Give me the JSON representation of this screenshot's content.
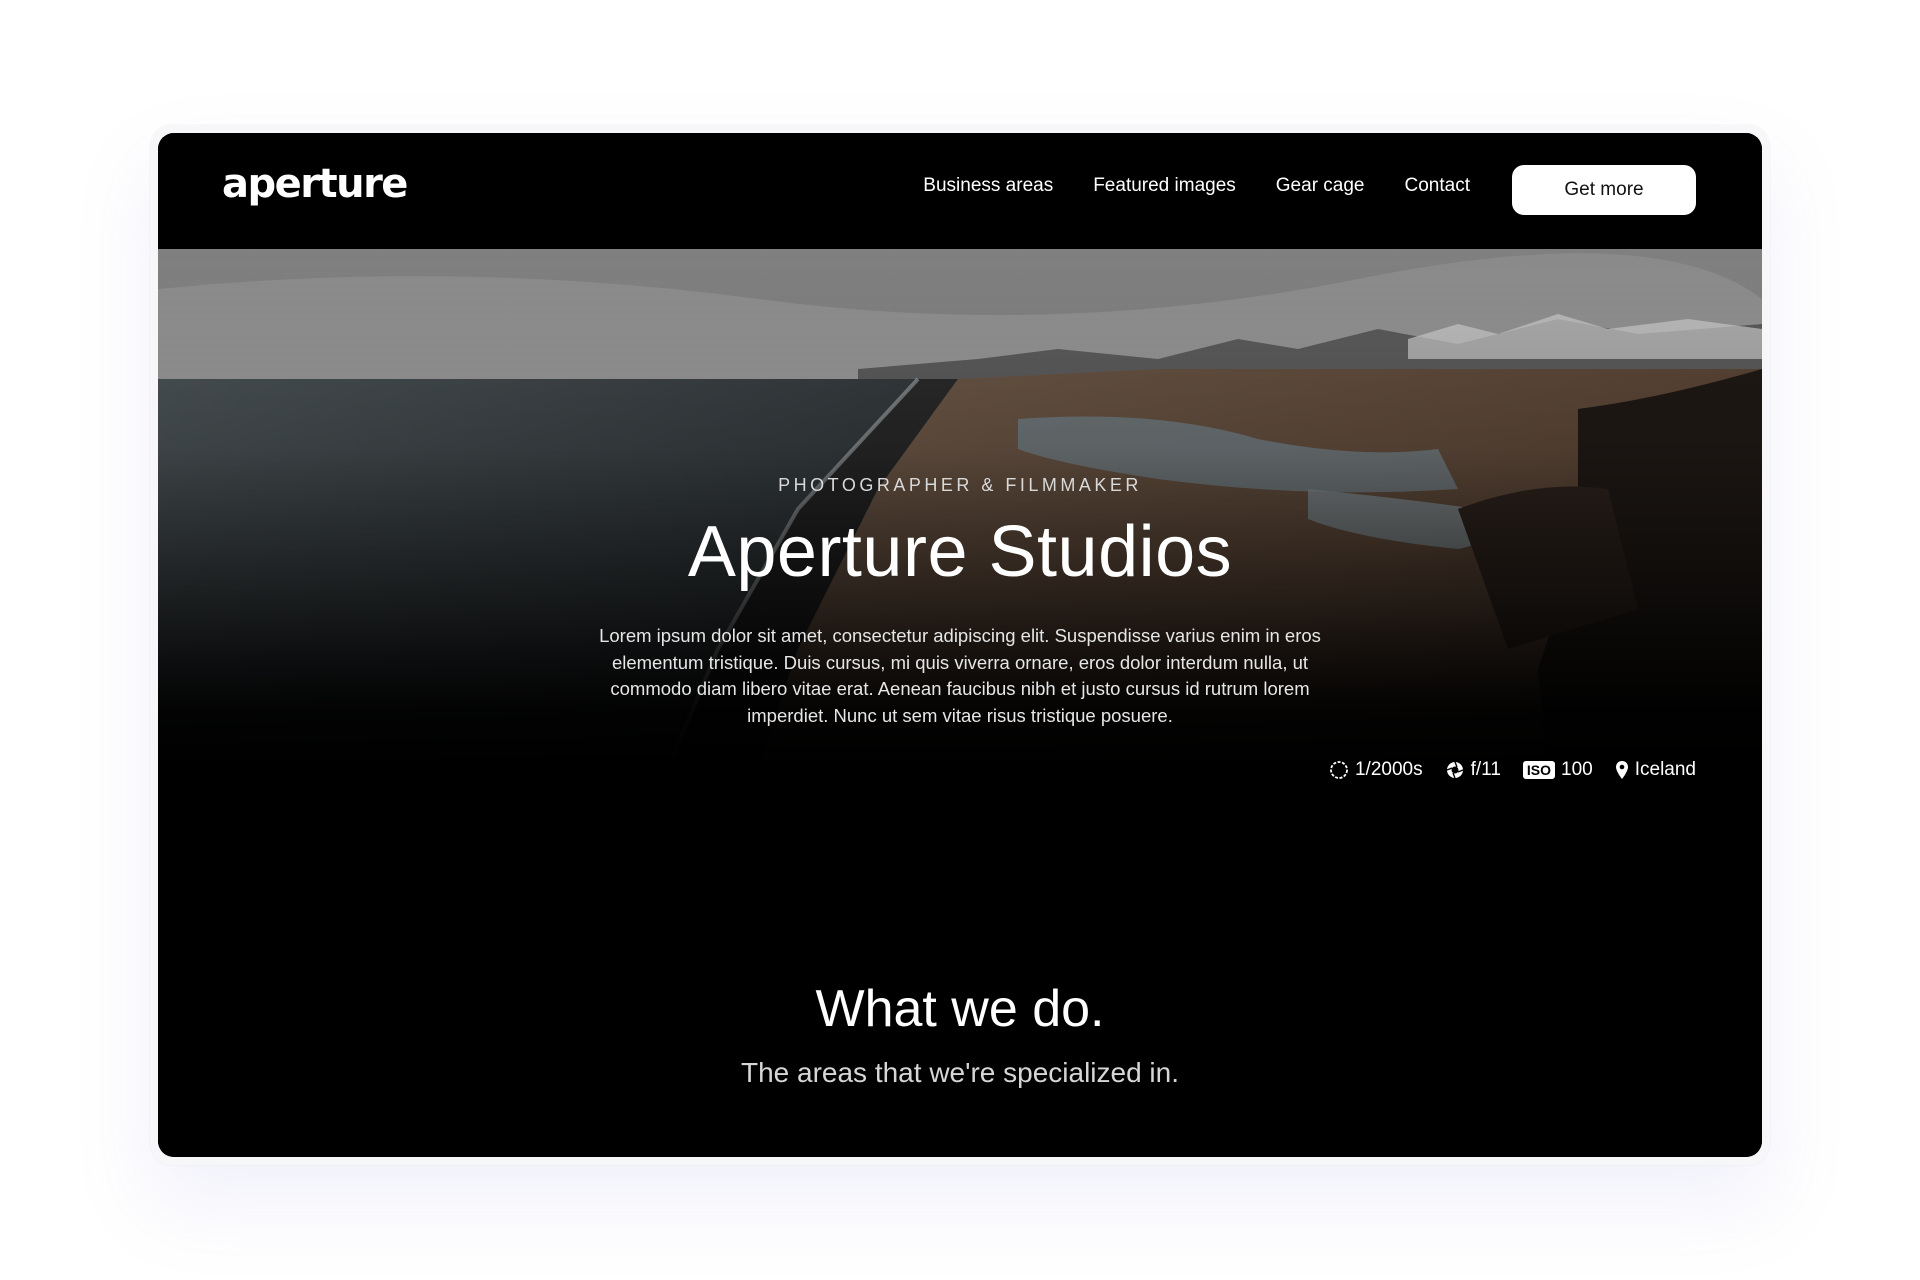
{
  "brand": {
    "logo": "aperture"
  },
  "nav": {
    "links": [
      "Business areas",
      "Featured images",
      "Gear cage",
      "Contact"
    ],
    "cta_label": "Get more"
  },
  "hero": {
    "kicker": "PHOTOGRAPHER & FILMMAKER",
    "title": "Aperture Studios",
    "body": "Lorem ipsum dolor sit amet, consectetur adipiscing elit. Suspendisse varius enim in eros elementum tristique. Duis cursus, mi quis viverra ornare, eros dolor interdum nulla, ut commodo diam libero vitae erat. Aenean faucibus nibh et justo cursus id rutrum lorem imperdiet. Nunc ut sem vitae risus tristique posuere.",
    "meta": {
      "shutter": "1/2000s",
      "aperture": "f/11",
      "iso_badge": "ISO",
      "iso": "100",
      "location": "Iceland"
    },
    "icons": {
      "shutter": "shutter-circle-icon",
      "aperture": "aperture-icon",
      "iso": "iso-badge-icon",
      "location": "map-pin-icon"
    }
  },
  "section": {
    "title": "What we do.",
    "subtitle": "The areas that we're specialized in."
  },
  "colors": {
    "background": "#000000",
    "text": "#ffffff",
    "button_bg": "#ffffff",
    "button_text": "#111111"
  }
}
